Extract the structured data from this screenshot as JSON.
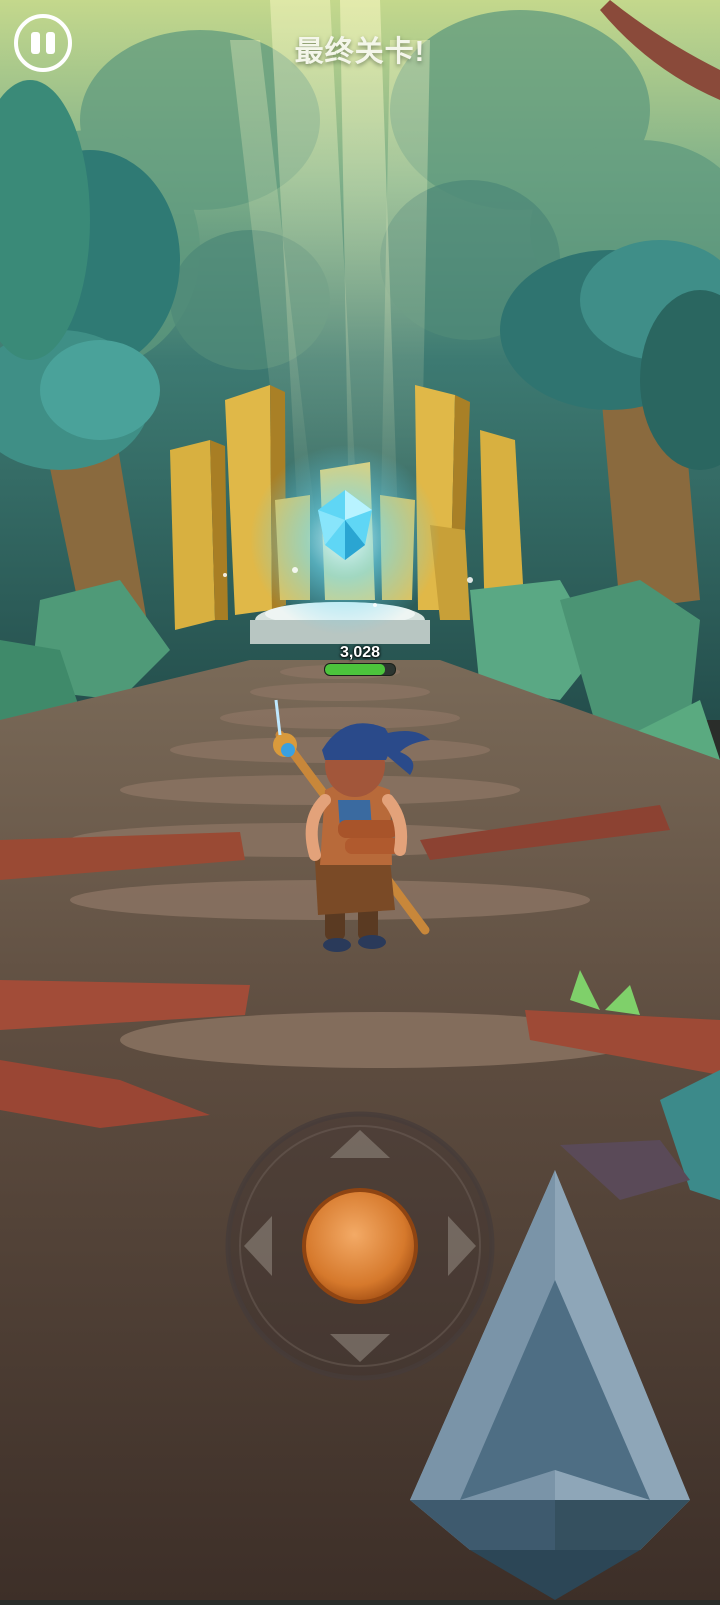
{
  "hud": {
    "level_title": "最终关卡!",
    "pause_icon": "pause-icon"
  },
  "crystal": {
    "hp_label": "3,028",
    "hp_fraction": 0.85,
    "icon": "crystal-icon"
  },
  "controls": {
    "joystick_icon": "dpad-joystick",
    "action_icon": "arrow-up-icon"
  },
  "colors": {
    "accent_orange": "#d97a2c",
    "hp_green": "#4cc43c",
    "crystal_blue": "#5ad4f7",
    "forest_teal": "#2f6a64"
  }
}
